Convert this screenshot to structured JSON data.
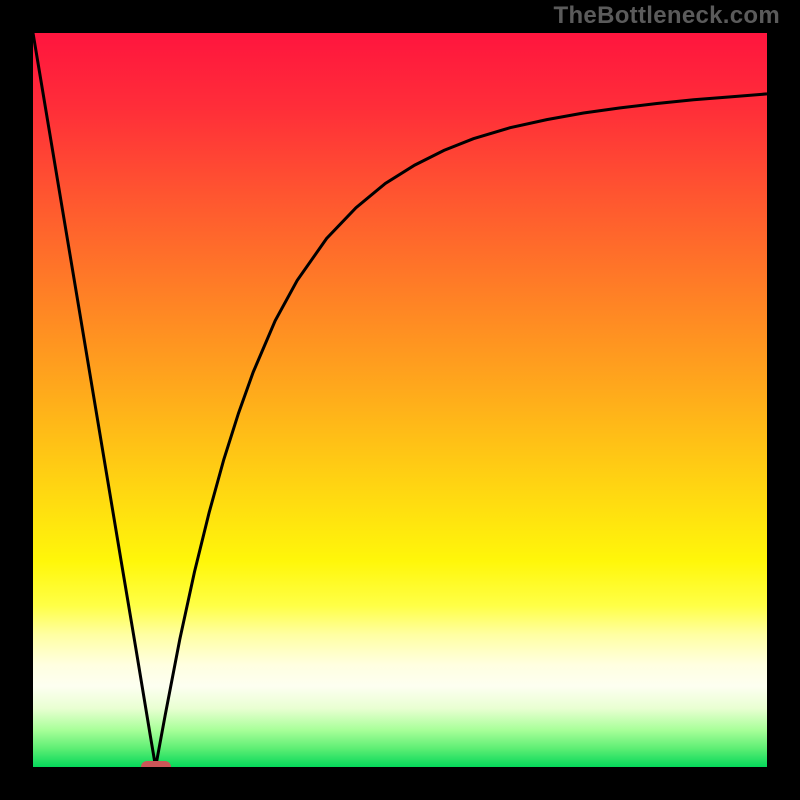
{
  "watermark": "TheBottleneck.com",
  "colors": {
    "gradient_stops": [
      {
        "offset": 0.0,
        "color": "#ff153e"
      },
      {
        "offset": 0.1,
        "color": "#ff2d39"
      },
      {
        "offset": 0.22,
        "color": "#ff5530"
      },
      {
        "offset": 0.35,
        "color": "#ff7e26"
      },
      {
        "offset": 0.48,
        "color": "#ffa71c"
      },
      {
        "offset": 0.6,
        "color": "#ffcf13"
      },
      {
        "offset": 0.72,
        "color": "#fff70a"
      },
      {
        "offset": 0.78,
        "color": "#ffff46"
      },
      {
        "offset": 0.82,
        "color": "#ffffa3"
      },
      {
        "offset": 0.86,
        "color": "#ffffe0"
      },
      {
        "offset": 0.89,
        "color": "#fdfff1"
      },
      {
        "offset": 0.92,
        "color": "#e9ffd2"
      },
      {
        "offset": 0.95,
        "color": "#a7ff98"
      },
      {
        "offset": 0.975,
        "color": "#5dee74"
      },
      {
        "offset": 1.0,
        "color": "#05d85a"
      }
    ],
    "curve": "#000000",
    "marker": "#cb5658",
    "frame": "#000000"
  },
  "chart_data": {
    "type": "line",
    "x": [
      0.0,
      0.02,
      0.04,
      0.06,
      0.08,
      0.1,
      0.12,
      0.14,
      0.16,
      0.167,
      0.18,
      0.2,
      0.22,
      0.24,
      0.26,
      0.28,
      0.3,
      0.33,
      0.36,
      0.4,
      0.44,
      0.48,
      0.52,
      0.56,
      0.6,
      0.65,
      0.7,
      0.75,
      0.8,
      0.85,
      0.9,
      0.95,
      1.0
    ],
    "y": [
      1.0,
      0.88,
      0.76,
      0.641,
      0.521,
      0.401,
      0.281,
      0.162,
      0.042,
      0.0,
      0.07,
      0.174,
      0.266,
      0.347,
      0.419,
      0.482,
      0.538,
      0.608,
      0.663,
      0.72,
      0.762,
      0.795,
      0.82,
      0.84,
      0.856,
      0.871,
      0.882,
      0.891,
      0.898,
      0.904,
      0.909,
      0.913,
      0.917
    ],
    "xlabel": "",
    "ylabel": "",
    "xlim": [
      0,
      1
    ],
    "ylim": [
      0,
      1
    ],
    "title": "",
    "legend": false,
    "marker_point": {
      "x": 0.167,
      "y": 0.0
    }
  }
}
